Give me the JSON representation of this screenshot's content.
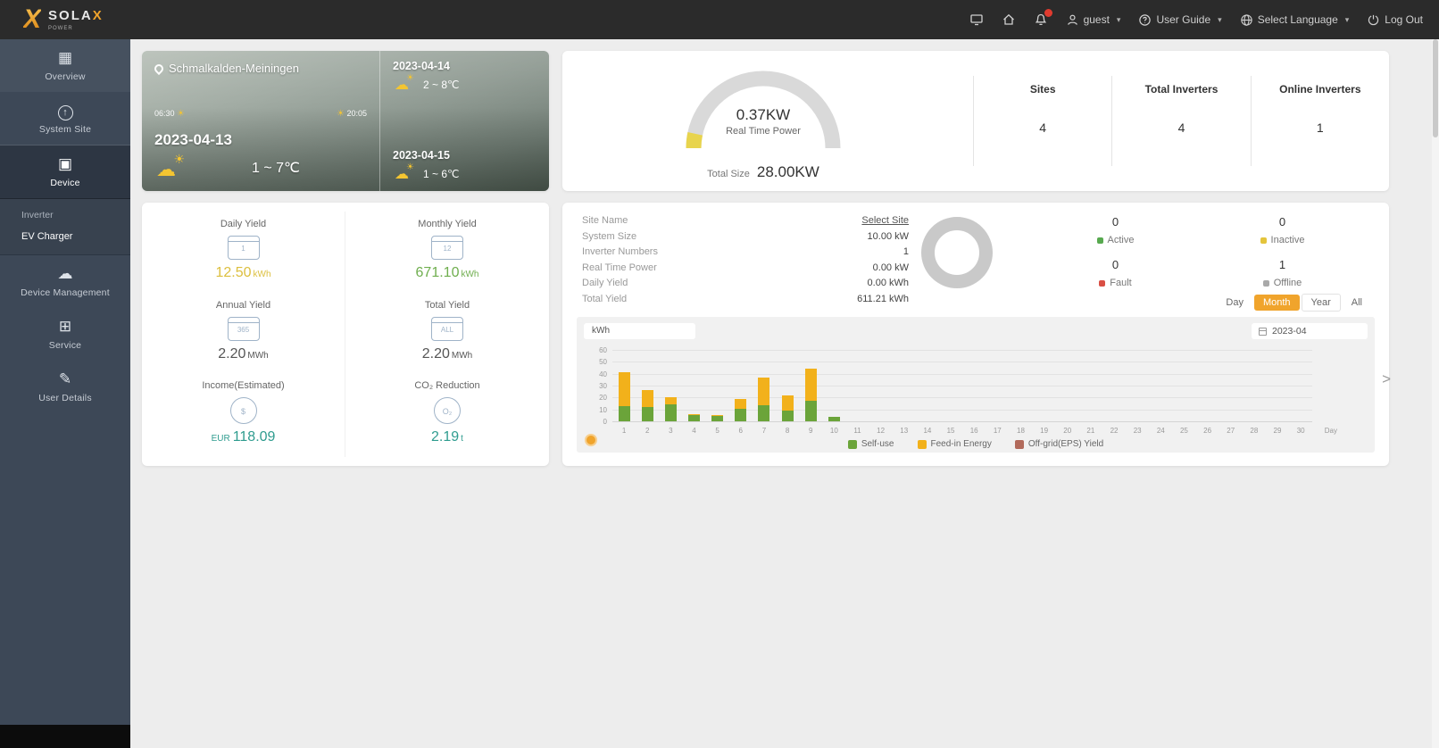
{
  "topbar": {
    "logo_text": "SOLA",
    "logo_x": "X",
    "logo_sub": "POWER",
    "user_label": "guest",
    "user_guide_label": "User Guide",
    "language_label": "Select Language",
    "logout_label": "Log Out"
  },
  "sidebar": {
    "items": [
      {
        "label": "Overview",
        "icon": "overview-icon",
        "glyph": "▦",
        "type": "main",
        "active": false,
        "first": true
      },
      {
        "label": "System Site",
        "icon": "system-site-icon",
        "glyph": "↑",
        "circle": true,
        "type": "main",
        "active": false
      },
      {
        "label": "Device",
        "icon": "device-icon",
        "glyph": "▣",
        "type": "main",
        "active": true
      },
      {
        "label": "Inverter",
        "type": "sub",
        "active": false
      },
      {
        "label": "EV Charger",
        "type": "sub",
        "active": true
      },
      {
        "label": "Device Management",
        "icon": "device-management-icon",
        "glyph": "☁",
        "type": "main",
        "active": false
      },
      {
        "label": "Service",
        "icon": "service-icon",
        "glyph": "⊞",
        "type": "main",
        "active": false
      },
      {
        "label": "User Details",
        "icon": "user-details-icon",
        "glyph": "✎",
        "type": "main",
        "active": false
      }
    ]
  },
  "weather": {
    "location": "Schmalkalden-Meiningen",
    "sunrise": "06:30",
    "sunset": "20:05",
    "today_date": "2023-04-13",
    "today_temp": "1 ~ 7℃",
    "forecast": [
      {
        "date": "2023-04-14",
        "temp": "2 ~ 8℃"
      },
      {
        "date": "2023-04-15",
        "temp": "1 ~ 6℃"
      }
    ]
  },
  "overview": {
    "power_value": "0.37KW",
    "power_label": "Real Time Power",
    "total_size_label": "Total Size",
    "total_size_value": "28.00KW",
    "stats": [
      {
        "label": "Sites",
        "value": "4"
      },
      {
        "label": "Total Inverters",
        "value": "4"
      },
      {
        "label": "Online Inverters",
        "value": "1"
      }
    ]
  },
  "yield_card": {
    "items": [
      {
        "label": "Daily Yield",
        "icon": "daily-yield-icon",
        "icon_text": "1",
        "prefix": "",
        "value": "12.50",
        "unit": "kWh",
        "color": "#dcbf3e"
      },
      {
        "label": "Monthly Yield",
        "icon": "monthly-yield-icon",
        "icon_text": "12",
        "prefix": "",
        "value": "671.10",
        "unit": "kWh",
        "color": "#6fae4e"
      },
      {
        "label": "Annual Yield",
        "icon": "annual-yield-icon",
        "icon_text": "365",
        "prefix": "",
        "value": "2.20",
        "unit": "MWh",
        "color": "#555555"
      },
      {
        "label": "Total Yield",
        "icon": "total-yield-icon",
        "icon_text": "ALL",
        "prefix": "",
        "value": "2.20",
        "unit": "MWh",
        "color": "#555555"
      },
      {
        "label": "Income(Estimated)",
        "icon": "income-icon",
        "icon_text": "$",
        "round": true,
        "prefix": "EUR",
        "value": "118.09",
        "unit": "",
        "color": "#2f9c8f"
      },
      {
        "label": "CO₂ Reduction",
        "icon": "co2-reduction-icon",
        "icon_text": "O₂",
        "round": true,
        "prefix": "",
        "value": "2.19",
        "unit": "t",
        "color": "#2f9c8f"
      }
    ]
  },
  "site_card": {
    "rows": [
      {
        "label": "Site Name",
        "value": "Select Site",
        "link": true
      },
      {
        "label": "System Size",
        "value": "10.00 kW"
      },
      {
        "label": "Inverter Numbers",
        "value": "1"
      },
      {
        "label": "Real Time Power",
        "value": "0.00 kW"
      },
      {
        "label": "Daily Yield",
        "value": "0.00 kWh"
      },
      {
        "label": "Total Yield",
        "value": "611.21 kWh"
      }
    ],
    "status": [
      {
        "count": "0",
        "label": "Active",
        "color": "#57a94f"
      },
      {
        "count": "0",
        "label": "Inactive",
        "color": "#e4c43c"
      },
      {
        "count": "0",
        "label": "Fault",
        "color": "#d94f44"
      },
      {
        "count": "1",
        "label": "Offline",
        "color": "#a9a9a9"
      }
    ],
    "period_tabs": [
      {
        "label": "Day",
        "active": false
      },
      {
        "label": "Month",
        "active": true
      },
      {
        "label": "Year",
        "active": false,
        "boxed": true
      },
      {
        "label": "All",
        "active": false
      }
    ],
    "date_value": "2023-04",
    "unit_pill": "kWh"
  },
  "chart_data": {
    "type": "bar",
    "stacked": true,
    "title": "",
    "xlabel": "Day",
    "ylabel": "kWh",
    "x": [
      1,
      2,
      3,
      4,
      5,
      6,
      7,
      8,
      9,
      10,
      11,
      12,
      13,
      14,
      15,
      16,
      17,
      18,
      19,
      20,
      21,
      22,
      23,
      24,
      25,
      26,
      27,
      28,
      29,
      30
    ],
    "ylim": [
      0,
      60
    ],
    "yticks": [
      0,
      10,
      20,
      30,
      40,
      50,
      60
    ],
    "grid": true,
    "legend_position": "bottom",
    "series": [
      {
        "name": "Self-use",
        "color": "#6ba43a",
        "values": [
          12.5,
          12,
          14,
          5,
          4.5,
          10.5,
          13.5,
          9,
          17,
          3.5,
          0,
          0,
          0,
          0,
          0,
          0,
          0,
          0,
          0,
          0,
          0,
          0,
          0,
          0,
          0,
          0,
          0,
          0,
          0,
          0
        ]
      },
      {
        "name": "Feed-in Energy",
        "color": "#f2b11b",
        "values": [
          28.5,
          14,
          6,
          1,
          0.5,
          8,
          23.5,
          13,
          27,
          0,
          0,
          0,
          0,
          0,
          0,
          0,
          0,
          0,
          0,
          0,
          0,
          0,
          0,
          0,
          0,
          0,
          0,
          0,
          0,
          0
        ]
      },
      {
        "name": "Off-grid(EPS) Yield",
        "color": "#b26a5b",
        "values": [
          0,
          0,
          0,
          0,
          0,
          0,
          0,
          0,
          0,
          0,
          0,
          0,
          0,
          0,
          0,
          0,
          0,
          0,
          0,
          0,
          0,
          0,
          0,
          0,
          0,
          0,
          0,
          0,
          0,
          0
        ]
      }
    ]
  }
}
